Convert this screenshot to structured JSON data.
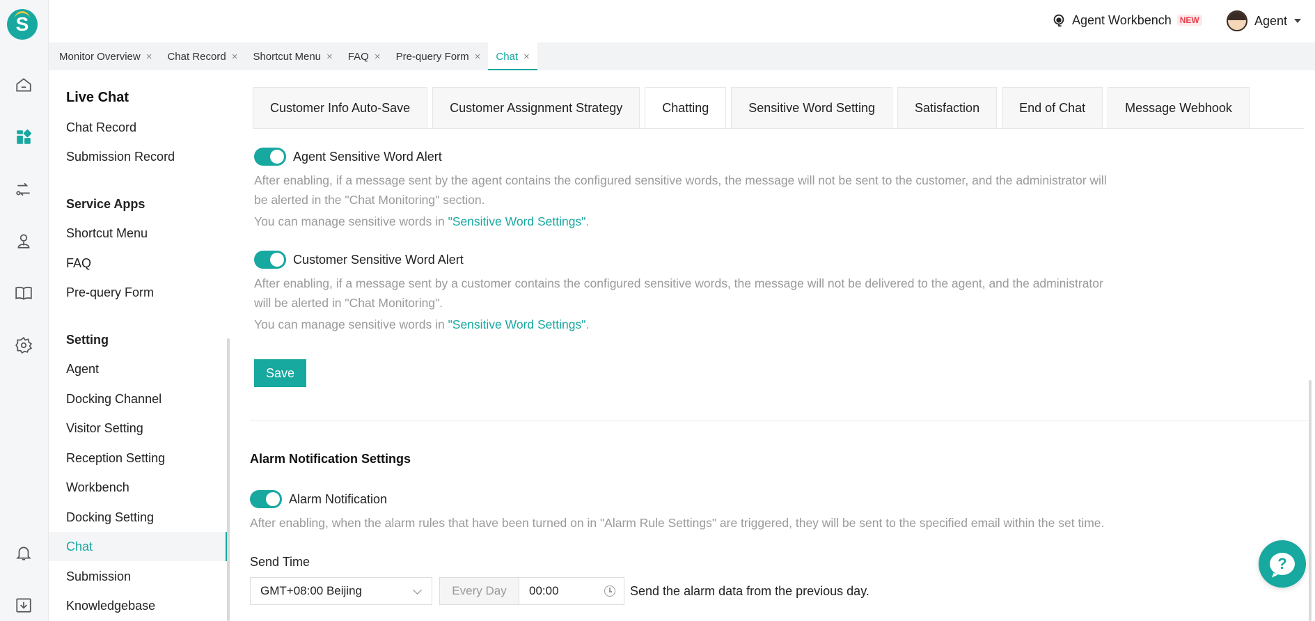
{
  "topbar": {
    "workbench_label": "Agent Workbench",
    "new_badge": "NEW",
    "user_name": "Agent"
  },
  "rail": {
    "icons": [
      "home-icon",
      "dashboard-icon",
      "routing-icon",
      "agent-icon",
      "book-icon",
      "settings-icon",
      "bell-icon",
      "download-icon"
    ]
  },
  "tabs": [
    {
      "label": "Monitor Overview",
      "close": "×"
    },
    {
      "label": "Chat Record",
      "close": "×"
    },
    {
      "label": "Shortcut Menu",
      "close": "×"
    },
    {
      "label": "FAQ",
      "close": "×"
    },
    {
      "label": "Pre-query Form",
      "close": "×"
    },
    {
      "label": "Chat",
      "close": "×"
    }
  ],
  "menu": {
    "title": "Live Chat",
    "live_chat_items": [
      "Chat Record",
      "Submission Record"
    ],
    "service_apps_title": "Service Apps",
    "service_apps_items": [
      "Shortcut Menu",
      "FAQ",
      "Pre-query Form"
    ],
    "setting_title": "Setting",
    "setting_items": [
      "Agent",
      "Docking Channel",
      "Visitor Setting",
      "Reception Setting",
      "Workbench",
      "Docking Setting",
      "Chat",
      "Submission",
      "Knowledgebase"
    ],
    "active_item": "Chat"
  },
  "subtabs": [
    "Customer Info Auto-Save",
    "Customer Assignment Strategy",
    "Chatting",
    "Sensitive Word Setting",
    "Satisfaction",
    "End of Chat",
    "Message Webhook"
  ],
  "active_subtab": "Chatting",
  "agent_alert": {
    "label": "Agent Sensitive Word Alert",
    "enabled": true,
    "desc": "After enabling, if a message sent by the agent contains the configured sensitive words, the message will not be sent to the customer, and the administrator will be alerted in the \"Chat Monitoring\" section.",
    "manage_prefix": "You can manage sensitive words in ",
    "manage_link": "\"Sensitive Word Settings\"",
    "manage_suffix": "."
  },
  "customer_alert": {
    "label": "Customer Sensitive Word Alert",
    "enabled": true,
    "desc": "After enabling, if a message sent by a customer contains the configured sensitive words, the message will not be delivered to the agent, and the administrator will be alerted in \"Chat Monitoring\".",
    "manage_prefix": "You can manage sensitive words in ",
    "manage_link": "\"Sensitive Word Settings\"",
    "manage_suffix": "."
  },
  "save_label": "Save",
  "alarm": {
    "section_title": "Alarm Notification Settings",
    "toggle_label": "Alarm Notification",
    "enabled": true,
    "desc": "After enabling, when the alarm rules that have been turned on in \"Alarm Rule Settings\" are triggered, they will be sent to the specified email within the set time.",
    "send_time_label": "Send Time",
    "timezone": "GMT+08:00 Beijing",
    "frequency": "Every Day",
    "time": "00:00",
    "after_text": "Send the alarm data from the previous day."
  },
  "help_symbol": "?",
  "colors": {
    "accent": "#17a8a0",
    "muted_text": "#9a9a9a"
  }
}
